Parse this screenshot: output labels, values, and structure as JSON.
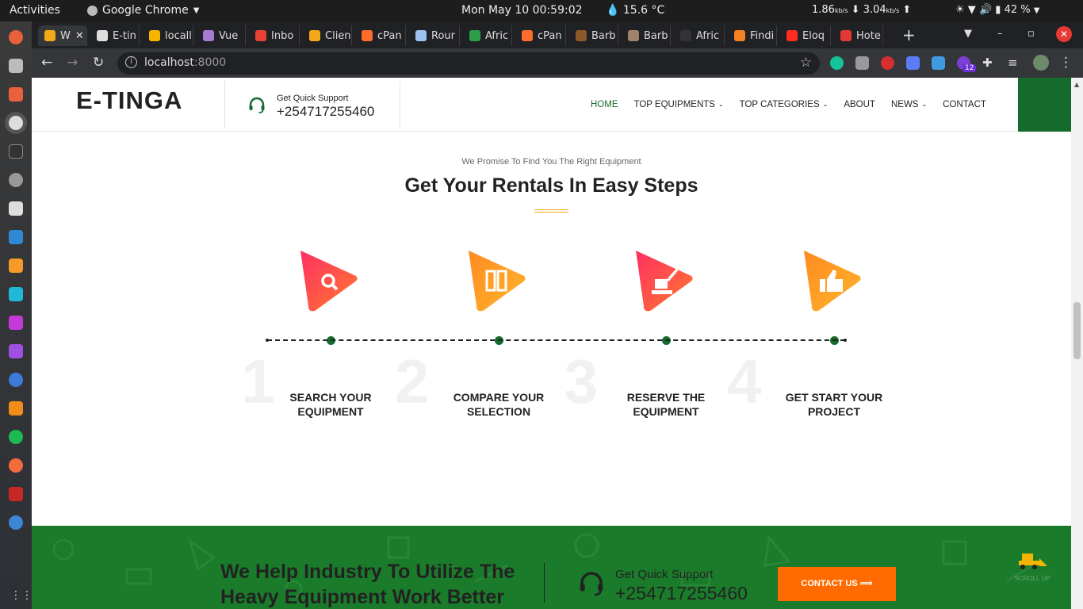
{
  "system": {
    "activities": "Activities",
    "app_name": "Google Chrome",
    "clock": "Mon May 10  00:59:02",
    "weather": "15.6 °C",
    "download_speed": "1.86",
    "download_unit": "kb/s",
    "upload_speed": "3.04",
    "upload_unit": "kb/s",
    "battery": "42 %"
  },
  "tabs": [
    {
      "label": "W",
      "icon": "yellow-app-icon",
      "color": "#f2a817",
      "active": true
    },
    {
      "label": "E-tin",
      "icon": "globe-icon",
      "color": "#dddddd"
    },
    {
      "label": "locall",
      "icon": "laravel-icon",
      "color": "#f5b400"
    },
    {
      "label": "Vue",
      "icon": "vue-icon",
      "color": "#a87bd0"
    },
    {
      "label": "Inbo",
      "icon": "gmail-icon",
      "color": "#e94235"
    },
    {
      "label": "Clien",
      "icon": "file-icon",
      "color": "#f2a817"
    },
    {
      "label": "cPan",
      "icon": "cpanel-icon",
      "color": "#ff6c2c"
    },
    {
      "label": "Rour",
      "icon": "cloud-icon",
      "color": "#9cc3f0"
    },
    {
      "label": "Afric",
      "icon": "africa-icon",
      "color": "#2e9e48"
    },
    {
      "label": "cPan",
      "icon": "cpanel-icon",
      "color": "#ff6c2c"
    },
    {
      "label": "Barb",
      "icon": "barber-icon",
      "color": "#8b5a2b"
    },
    {
      "label": "Barb",
      "icon": "barber-icon",
      "color": "#a0836d"
    },
    {
      "label": "Afric",
      "icon": "github-icon",
      "color": "#333333"
    },
    {
      "label": "Findi",
      "icon": "stackoverflow-icon",
      "color": "#f48024"
    },
    {
      "label": "Eloq",
      "icon": "laravel-icon",
      "color": "#ff2d20"
    },
    {
      "label": "Hote",
      "icon": "hotel-icon",
      "color": "#e53935"
    }
  ],
  "browser": {
    "url_host": "localhost",
    "url_port": ":8000",
    "extension_badge": "12"
  },
  "site": {
    "logo": "E-TINGA",
    "support_label": "Get Quick Support",
    "support_phone": "+254717255460",
    "nav": [
      {
        "label": "HOME",
        "active": true,
        "dropdown": false
      },
      {
        "label": "TOP EQUIPMENTS",
        "active": false,
        "dropdown": true
      },
      {
        "label": "TOP CATEGORIES",
        "active": false,
        "dropdown": true
      },
      {
        "label": "ABOUT",
        "active": false,
        "dropdown": false
      },
      {
        "label": "NEWS",
        "active": false,
        "dropdown": true
      },
      {
        "label": "CONTACT",
        "active": false,
        "dropdown": false
      }
    ],
    "brand_green": "#146b2c",
    "accent_orange": "#ff6b00"
  },
  "steps_section": {
    "subtitle": "We Promise To Find You The Right Equipment",
    "title": "Get Your Rentals In Easy Steps",
    "steps": [
      {
        "number": "1",
        "line1": "SEARCH YOUR",
        "line2": "EQUIPMENT",
        "icon": "search-icon"
      },
      {
        "number": "2",
        "line1": "COMPARE YOUR",
        "line2": "SELECTION",
        "icon": "compare-icon"
      },
      {
        "number": "3",
        "line1": "RESERVE THE",
        "line2": "EQUIPMENT",
        "icon": "excavator-icon"
      },
      {
        "number": "4",
        "line1": "GET START YOUR",
        "line2": "PROJECT",
        "icon": "thumbs-up-icon"
      }
    ]
  },
  "cta": {
    "title_line1": "We Help Industry To Utilize The",
    "title_line2": "Heavy Equipment Work Better",
    "support_label": "Get Quick Support",
    "support_phone": "+254717255460",
    "button": "CONTACT US",
    "scroll_up": "SCROLL UP"
  }
}
